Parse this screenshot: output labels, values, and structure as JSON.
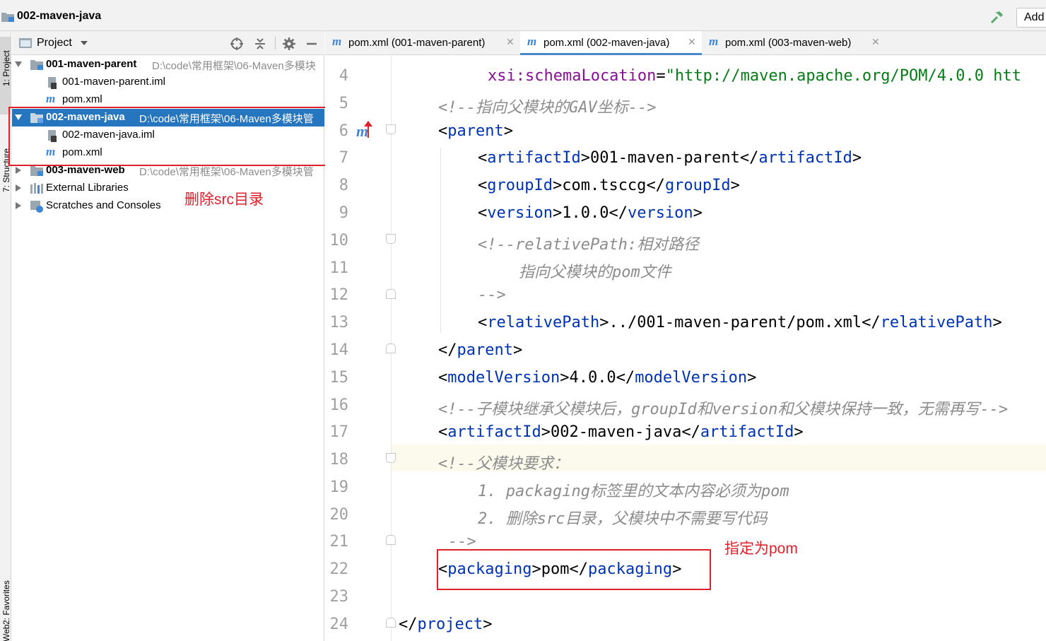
{
  "window": {
    "title": "002-maven-java",
    "add_button": "Add"
  },
  "tool_strip": {
    "project": "1: Project",
    "structure": "7: Structure",
    "favorites": "2: Favorites",
    "web": "Web"
  },
  "project_panel": {
    "title": "Project",
    "tree": [
      {
        "name": "001-maven-parent",
        "path": "D:\\code\\常用框架\\06-Maven多模块"
      },
      {
        "name": "001-maven-parent.iml"
      },
      {
        "name": "pom.xml"
      },
      {
        "name": "002-maven-java",
        "path": "D:\\code\\常用框架\\06-Maven多模块管"
      },
      {
        "name": "002-maven-java.iml"
      },
      {
        "name": "pom.xml"
      },
      {
        "name": "003-maven-web",
        "path": "D:\\code\\常用框架\\06-Maven多模块管"
      },
      {
        "name": "External Libraries"
      },
      {
        "name": "Scratches and Consoles"
      }
    ]
  },
  "annotations": {
    "delete_src": "删除src目录",
    "set_pom": "指定为pom"
  },
  "tabs": [
    {
      "label": "pom.xml (001-maven-parent)"
    },
    {
      "label": "pom.xml (002-maven-java)"
    },
    {
      "label": "pom.xml (003-maven-web)"
    }
  ],
  "editor": {
    "line_numbers": [
      "4",
      "5",
      "6",
      "7",
      "8",
      "9",
      "10",
      "11",
      "12",
      "13",
      "14",
      "15",
      "16",
      "17",
      "18",
      "19",
      "20",
      "21",
      "22",
      "23",
      "24"
    ],
    "code": {
      "l4_attr": "xsi:schemaLocation",
      "l4_val": "\"http://maven.apache.org/POM/4.0.0 htt",
      "l5": "<!--指向父模块的GAV坐标-->",
      "l6_tag": "parent",
      "l7_tag": "artifactId",
      "l7_text": "001-maven-parent",
      "l8_tag": "groupId",
      "l8_text": "com.tsccg",
      "l9_tag": "version",
      "l9_text": "1.0.0",
      "l10": "<!--relativePath:相对路径",
      "l11": "指向父模块的pom文件",
      "l12": "-->",
      "l13_tag": "relativePath",
      "l13_text": "../001-maven-parent/pom.xml",
      "l14_tag": "parent",
      "l15_tag": "modelVersion",
      "l15_text": "4.0.0",
      "l16": "<!--子模块继承父模块后，groupId和version和父模块保持一致，无需再写-->",
      "l17_tag": "artifactId",
      "l17_text": "002-maven-java",
      "l18": "<!--父模块要求：",
      "l19": "1. packaging标签里的文本内容必须为pom",
      "l20": "2. 删除src目录，父模块中不需要写代码",
      "l21": "-->",
      "l22_tag": "packaging",
      "l22_text": "pom",
      "l24_tag": "project"
    }
  },
  "colors": {
    "tag": "#0033b3",
    "attr": "#871094",
    "string": "#067d17",
    "comment": "#8c8c8c",
    "selection": "#2675bf",
    "annotation": "#e0202a"
  }
}
